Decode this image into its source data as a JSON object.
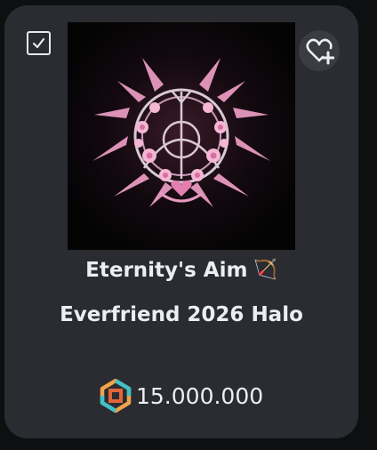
{
  "item": {
    "name_line1": "Eternity's Aim",
    "name_line2": "Everfriend 2026 Halo",
    "name_emoji": "🏹",
    "price": "15.000.000",
    "currency_icon": "robux-icon"
  },
  "controls": {
    "select_icon": "checkbox-checked-icon",
    "favorite_icon": "heart-plus-icon"
  },
  "colors": {
    "card_bg": "#2a2c31",
    "text": "#eceef2",
    "thumb_bg": "#050405",
    "halo_pink": "#e8a6c6"
  }
}
